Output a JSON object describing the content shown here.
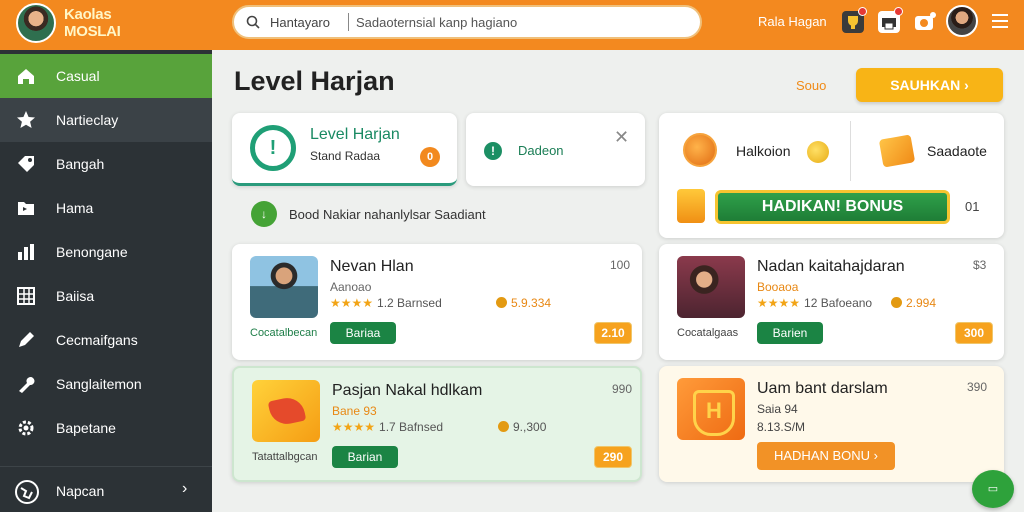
{
  "header": {
    "brand_name": "Kaolas MOSLAI",
    "search_text": "Hantayaro",
    "search_placeholder": "Sadaoternsial kanp hagiano",
    "user_name": "Rala Hagan",
    "notif_icons": [
      "trophy-icon",
      "printer-icon",
      "camera-icon"
    ],
    "brand_color": "#f3891f"
  },
  "sidebar": {
    "items": [
      {
        "label": "Casual",
        "icon": "home-icon",
        "active": true
      },
      {
        "label": "Nartieclay",
        "icon": "star-icon"
      },
      {
        "label": "Bangah",
        "icon": "tag-icon"
      },
      {
        "label": "Hama",
        "icon": "folder-icon"
      },
      {
        "label": "Benongane",
        "icon": "chart-icon"
      },
      {
        "label": "Baiisa",
        "icon": "grid-icon"
      },
      {
        "label": "Cecmaifgans",
        "icon": "pencil-icon"
      },
      {
        "label": "Sanglaitemon",
        "icon": "wrench-icon"
      },
      {
        "label": "Bapetane",
        "icon": "gear-icon"
      }
    ],
    "bottom": {
      "label": "Napcan",
      "icon": "globe-icon"
    },
    "active_color": "#58a33b"
  },
  "main": {
    "title": "Level Harjan",
    "sort_label": "Souo",
    "primary_button": "SAUHKAN",
    "level_card": {
      "title": "Level Harjan",
      "subtitle": "Stand Radaa",
      "badge": "0"
    },
    "tip_card": {
      "text": "Dadeon"
    },
    "info_text": "Bood Nakiar nahanlylsar Saadiant",
    "bonus": {
      "label_1": "Halkoion",
      "label_2": "Saadaote",
      "button": "HADIKAN! BONUS",
      "count": "01"
    },
    "games": [
      {
        "title": "Nevan Hlan",
        "subtitle": "Aanoao",
        "rating_stars": "★★★★",
        "reviews": "1.2 Barnsed",
        "price": "5.9.334",
        "corner": "100",
        "caption": "Cocatalbecan",
        "button": "Bariaa",
        "tag": "2.10"
      },
      {
        "title": "Nadan kaitahajdaran",
        "subtitle": "Booaoa",
        "rating_stars": "★★★★",
        "reviews": "12 Bafoeano",
        "price": "2.994",
        "corner": "$3",
        "caption": "Cocatalgaas",
        "button": "Barien",
        "tag": "300"
      },
      {
        "title": "Pasjan Nakal hdlkam",
        "subtitle": "Bane 93",
        "rating_stars": "★★★★",
        "reviews": "1.7 Bafnsed",
        "price": "9.,300",
        "corner": "990",
        "caption": "Tatattalbgcan",
        "button": "Barian",
        "tag": "290"
      },
      {
        "title": "Uam bant darslam",
        "subtitle": "Saia 94",
        "extra": "8.13.S/M",
        "corner": "390",
        "button": "HADHAN BONU"
      }
    ]
  }
}
